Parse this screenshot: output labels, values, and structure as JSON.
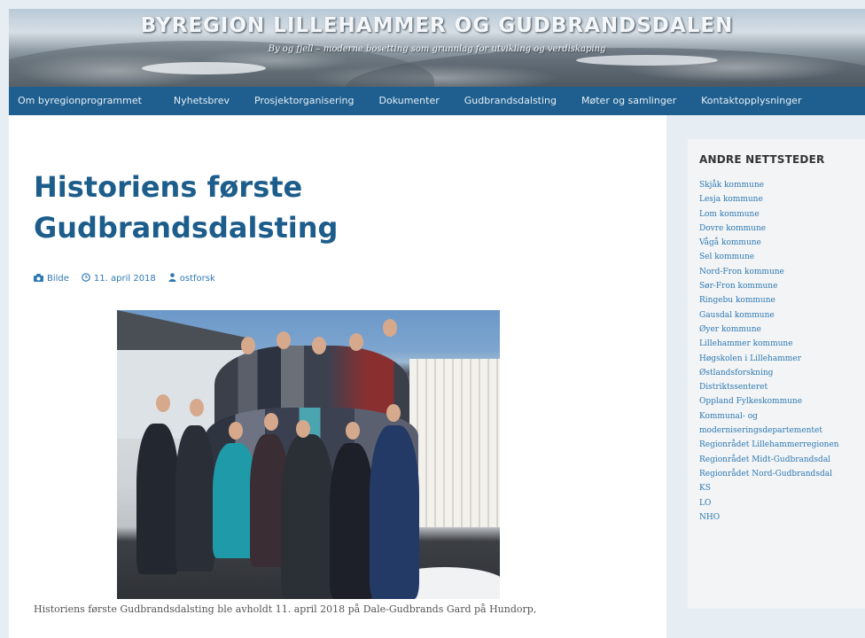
{
  "header": {
    "site_title": "BYREGION LILLEHAMMER OG GUDBRANDSDALEN",
    "tagline": "By og fjell – moderne bosetting som grunnlag for utvikling og verdiskaping"
  },
  "nav": {
    "items": [
      "Om byregionprogrammet",
      "Nyhetsbrev",
      "Prosjektorganisering",
      "Dokumenter",
      "Gudbrandsdalsting",
      "Møter og samlinger",
      "Kontaktopplysninger"
    ]
  },
  "post": {
    "title": "Historiens første Gudbrandsdalsting",
    "meta": {
      "format": "Bilde",
      "date": "11. april 2018",
      "author": "ostforsk"
    },
    "caption": "Historiens første Gudbrandsdalsting ble avholdt 11. april 2018 på Dale-Gudbrands Gard på Hundorp,"
  },
  "sidebar": {
    "heading": "ANDRE NETTSTEDER",
    "links": [
      "Skjåk kommune",
      "Lesja kommune",
      "Lom kommune",
      "Dovre kommune",
      "Vågå kommune",
      "Sel kommune",
      "Nord-Fron kommune",
      "Sør-Fron kommune",
      "Ringebu kommune",
      "Gausdal kommune",
      "Øyer kommune",
      "Lillehammer kommune",
      "Høgskolen i Lillehammer",
      "Østlandsforskning",
      "Distriktssenteret",
      "Oppland Fylkeskommune",
      "Kommunal- og",
      "moderniseringsdepartementet",
      "Regionrådet Lillehammerregionen",
      "Regionrådet Midt-Gudbrandsdal",
      "Regionrådet Nord-Gudbrandsdal",
      "KS",
      "LO",
      "NHO"
    ]
  },
  "colors": {
    "nav_bg": "#1e5f8f",
    "title": "#1d5d8c",
    "link": "#2e79b3"
  }
}
